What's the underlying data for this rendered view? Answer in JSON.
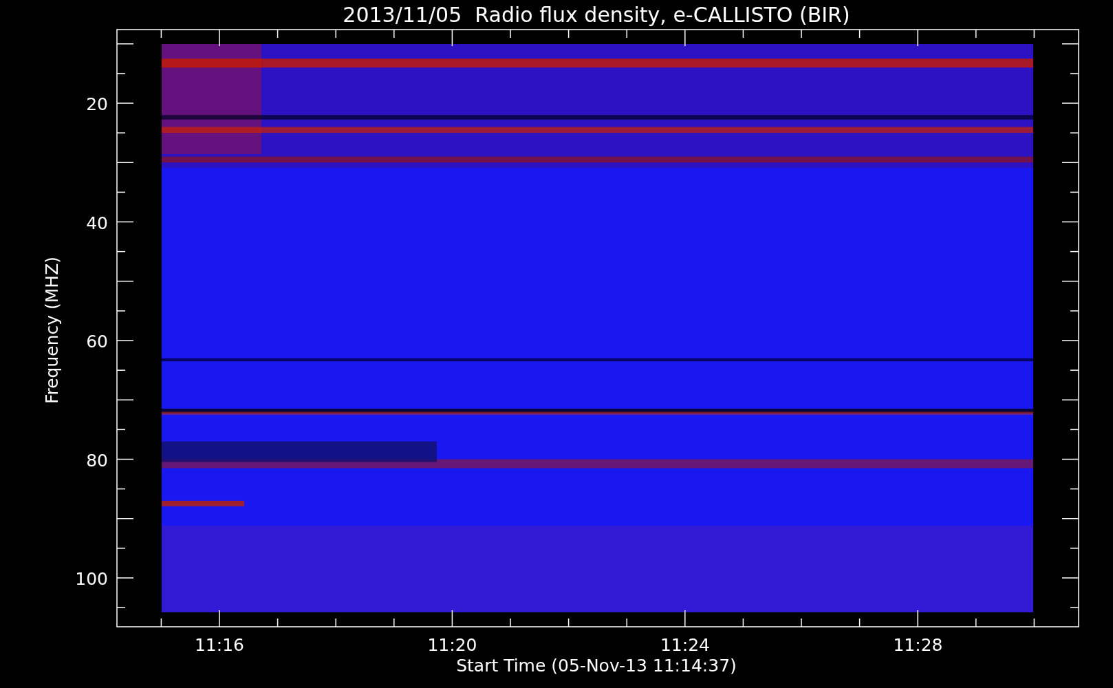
{
  "title": "2013/11/05  Radio flux density, e-CALLISTO (BIR)",
  "x_axis": {
    "label": "Start Time (05-Nov-13 11:14:37)",
    "ticks": [
      "11:16",
      "11:20",
      "11:24",
      "11:28"
    ]
  },
  "y_axis": {
    "label": "Frequency (MHZ)",
    "ticks": [
      "20",
      "40",
      "60",
      "80",
      "100"
    ]
  }
}
